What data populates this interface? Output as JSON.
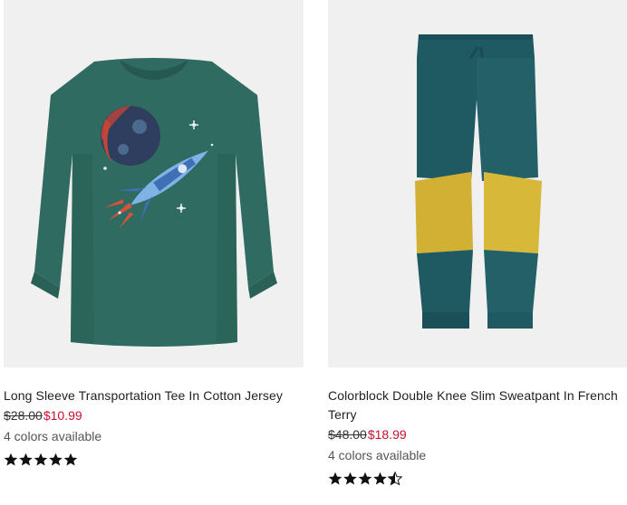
{
  "products": [
    {
      "title": "Long Sleeve Transportation Tee In Cotton Jersey",
      "original_price": "$28.00",
      "sale_price": "$10.99",
      "colors": "4 colors available",
      "rating": 5
    },
    {
      "title": "Colorblock Double Knee Slim Sweatpant In French Terry",
      "original_price": "$48.00",
      "sale_price": "$18.99",
      "colors": "4 colors available",
      "rating": 4.5
    }
  ],
  "colors": {
    "sale": "#c8102e",
    "tee_green": "#2f6b60",
    "pant_teal": "#1f5a62",
    "pant_yellow": "#d2b033",
    "image_bg": "#f0f0f0"
  }
}
